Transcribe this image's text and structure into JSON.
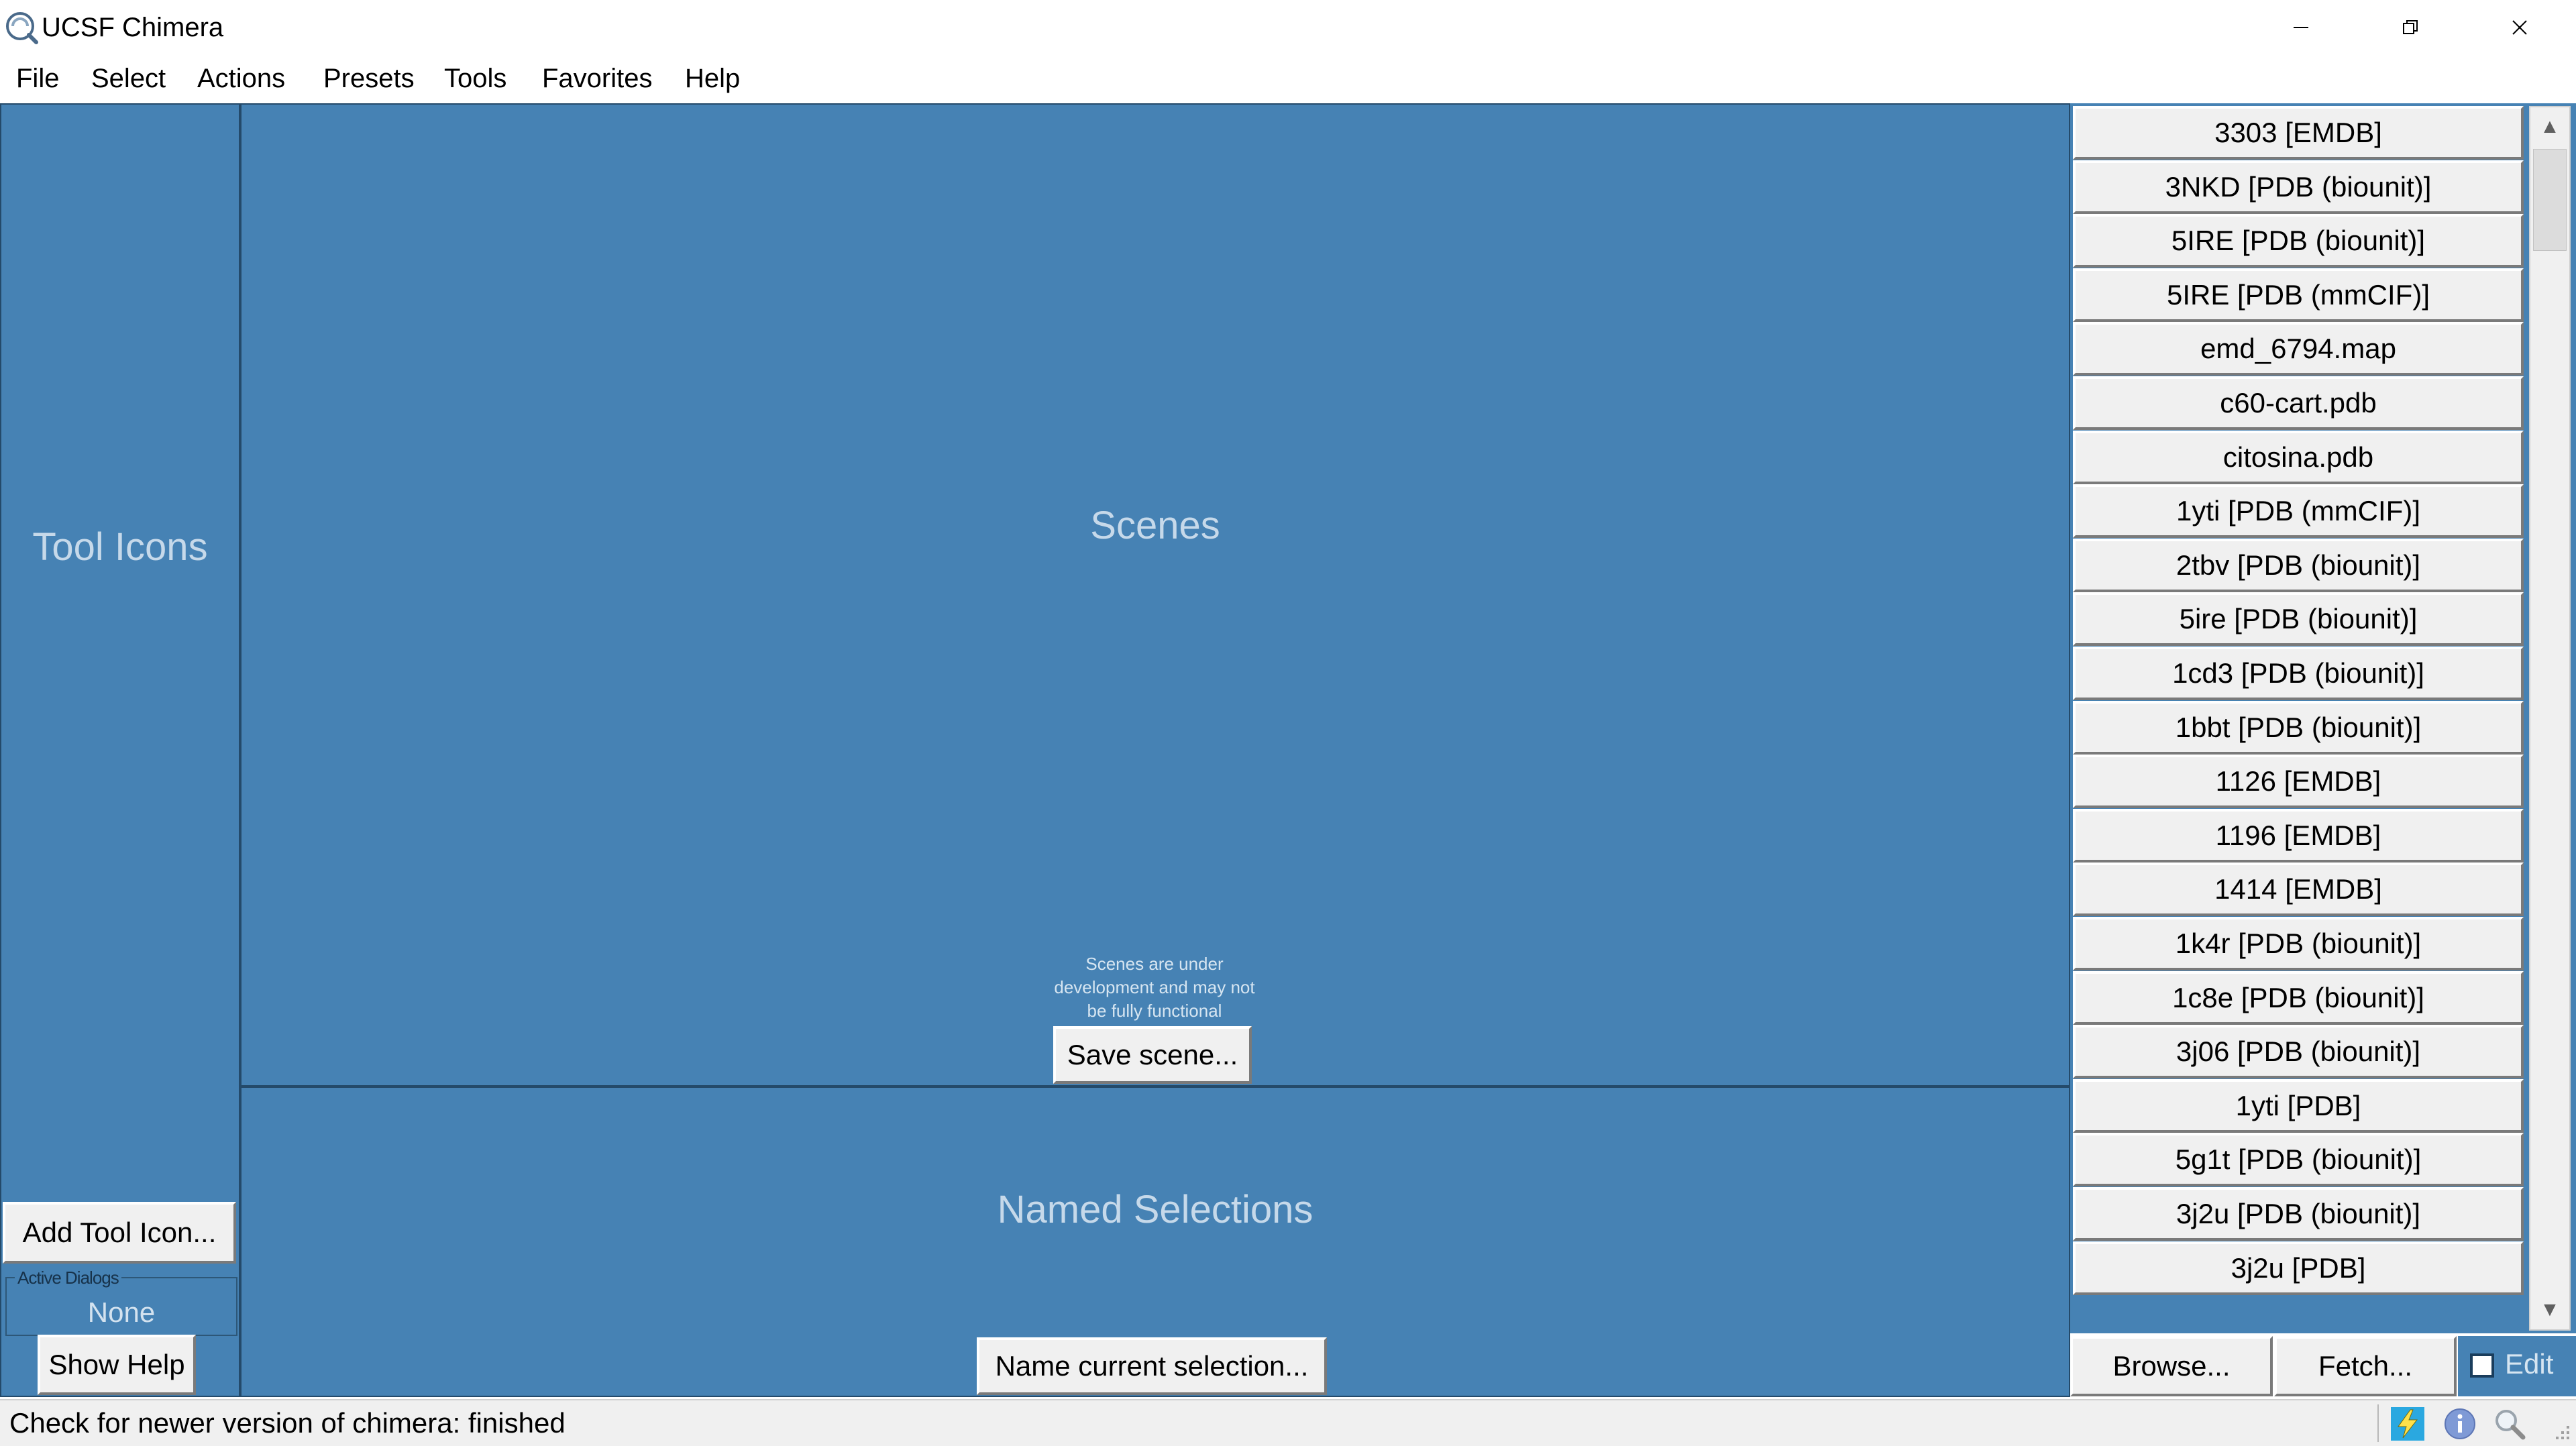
{
  "window": {
    "title": "UCSF Chimera"
  },
  "menubar": {
    "items": [
      "File",
      "Select",
      "Actions",
      "Presets",
      "Tools",
      "Favorites",
      "Help"
    ]
  },
  "tool_panel": {
    "label": "Tool Icons",
    "add_button": "Add Tool Icon...",
    "active_dialogs_label": "Active Dialogs",
    "active_dialogs_value": "None",
    "show_help_button": "Show Help"
  },
  "scenes": {
    "label": "Scenes",
    "note": "Scenes are under development and may not be fully functional",
    "save_button": "Save scene..."
  },
  "named_selections": {
    "label": "Named Selections",
    "name_button": "Name current selection..."
  },
  "models": [
    "3303 [EMDB]",
    "3NKD [PDB (biounit)]",
    "5IRE [PDB (biounit)]",
    "5IRE [PDB (mmCIF)]",
    "emd_6794.map",
    "c60-cart.pdb",
    "citosina.pdb",
    "1yti [PDB (mmCIF)]",
    "2tbv [PDB (biounit)]",
    "5ire [PDB (biounit)]",
    "1cd3 [PDB (biounit)]",
    "1bbt [PDB (biounit)]",
    "1126 [EMDB]",
    "1196 [EMDB]",
    "1414 [EMDB]",
    "1k4r [PDB (biounit)]",
    "1c8e [PDB (biounit)]",
    "3j06 [PDB (biounit)]",
    "1yti [PDB]",
    "5g1t [PDB (biounit)]",
    "3j2u [PDB (biounit)]",
    "3j2u [PDB]"
  ],
  "model_actions": {
    "browse": "Browse...",
    "fetch": "Fetch...",
    "edit": "Edit",
    "edit_checked": false
  },
  "status": {
    "text": "Check for newer version of chimera: finished",
    "icons": [
      "lightning-icon",
      "info-icon",
      "magnifier-icon"
    ]
  },
  "colors": {
    "panel_background": "#4682b4",
    "panel_label_text": "#c6d9ea",
    "button_face": "#f0f0f0",
    "statusbar": "#f0f0f0",
    "lightning_accent": "#2aa8e0"
  }
}
